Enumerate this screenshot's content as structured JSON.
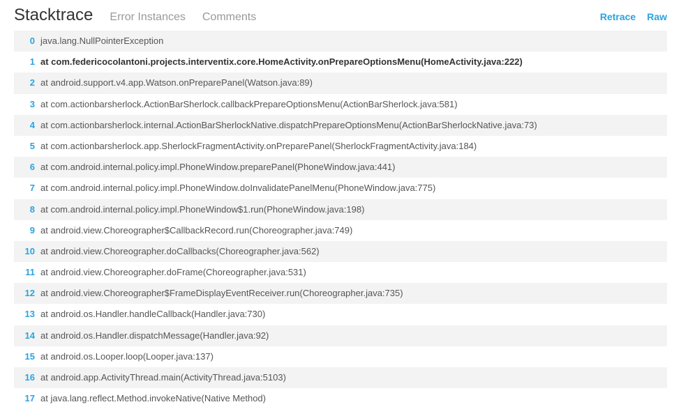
{
  "tabs": {
    "stacktrace": "Stacktrace",
    "error_instances": "Error Instances",
    "comments": "Comments"
  },
  "actions": {
    "retrace": "Retrace",
    "raw": "Raw"
  },
  "frames": [
    {
      "num": "0",
      "text": "java.lang.NullPointerException",
      "highlight": false
    },
    {
      "num": "1",
      "text": "at com.federicocolantoni.projects.interventix.core.HomeActivity.onPrepareOptionsMenu(HomeActivity.java:222)",
      "highlight": true
    },
    {
      "num": "2",
      "text": "at android.support.v4.app.Watson.onPreparePanel(Watson.java:89)",
      "highlight": false
    },
    {
      "num": "3",
      "text": "at com.actionbarsherlock.ActionBarSherlock.callbackPrepareOptionsMenu(ActionBarSherlock.java:581)",
      "highlight": false
    },
    {
      "num": "4",
      "text": "at com.actionbarsherlock.internal.ActionBarSherlockNative.dispatchPrepareOptionsMenu(ActionBarSherlockNative.java:73)",
      "highlight": false
    },
    {
      "num": "5",
      "text": "at com.actionbarsherlock.app.SherlockFragmentActivity.onPreparePanel(SherlockFragmentActivity.java:184)",
      "highlight": false
    },
    {
      "num": "6",
      "text": "at com.android.internal.policy.impl.PhoneWindow.preparePanel(PhoneWindow.java:441)",
      "highlight": false
    },
    {
      "num": "7",
      "text": "at com.android.internal.policy.impl.PhoneWindow.doInvalidatePanelMenu(PhoneWindow.java:775)",
      "highlight": false
    },
    {
      "num": "8",
      "text": "at com.android.internal.policy.impl.PhoneWindow$1.run(PhoneWindow.java:198)",
      "highlight": false
    },
    {
      "num": "9",
      "text": "at android.view.Choreographer$CallbackRecord.run(Choreographer.java:749)",
      "highlight": false
    },
    {
      "num": "10",
      "text": "at android.view.Choreographer.doCallbacks(Choreographer.java:562)",
      "highlight": false
    },
    {
      "num": "11",
      "text": "at android.view.Choreographer.doFrame(Choreographer.java:531)",
      "highlight": false
    },
    {
      "num": "12",
      "text": "at android.view.Choreographer$FrameDisplayEventReceiver.run(Choreographer.java:735)",
      "highlight": false
    },
    {
      "num": "13",
      "text": "at android.os.Handler.handleCallback(Handler.java:730)",
      "highlight": false
    },
    {
      "num": "14",
      "text": "at android.os.Handler.dispatchMessage(Handler.java:92)",
      "highlight": false
    },
    {
      "num": "15",
      "text": "at android.os.Looper.loop(Looper.java:137)",
      "highlight": false
    },
    {
      "num": "16",
      "text": "at android.app.ActivityThread.main(ActivityThread.java:5103)",
      "highlight": false
    },
    {
      "num": "17",
      "text": "at java.lang.reflect.Method.invokeNative(Native Method)",
      "highlight": false
    }
  ]
}
